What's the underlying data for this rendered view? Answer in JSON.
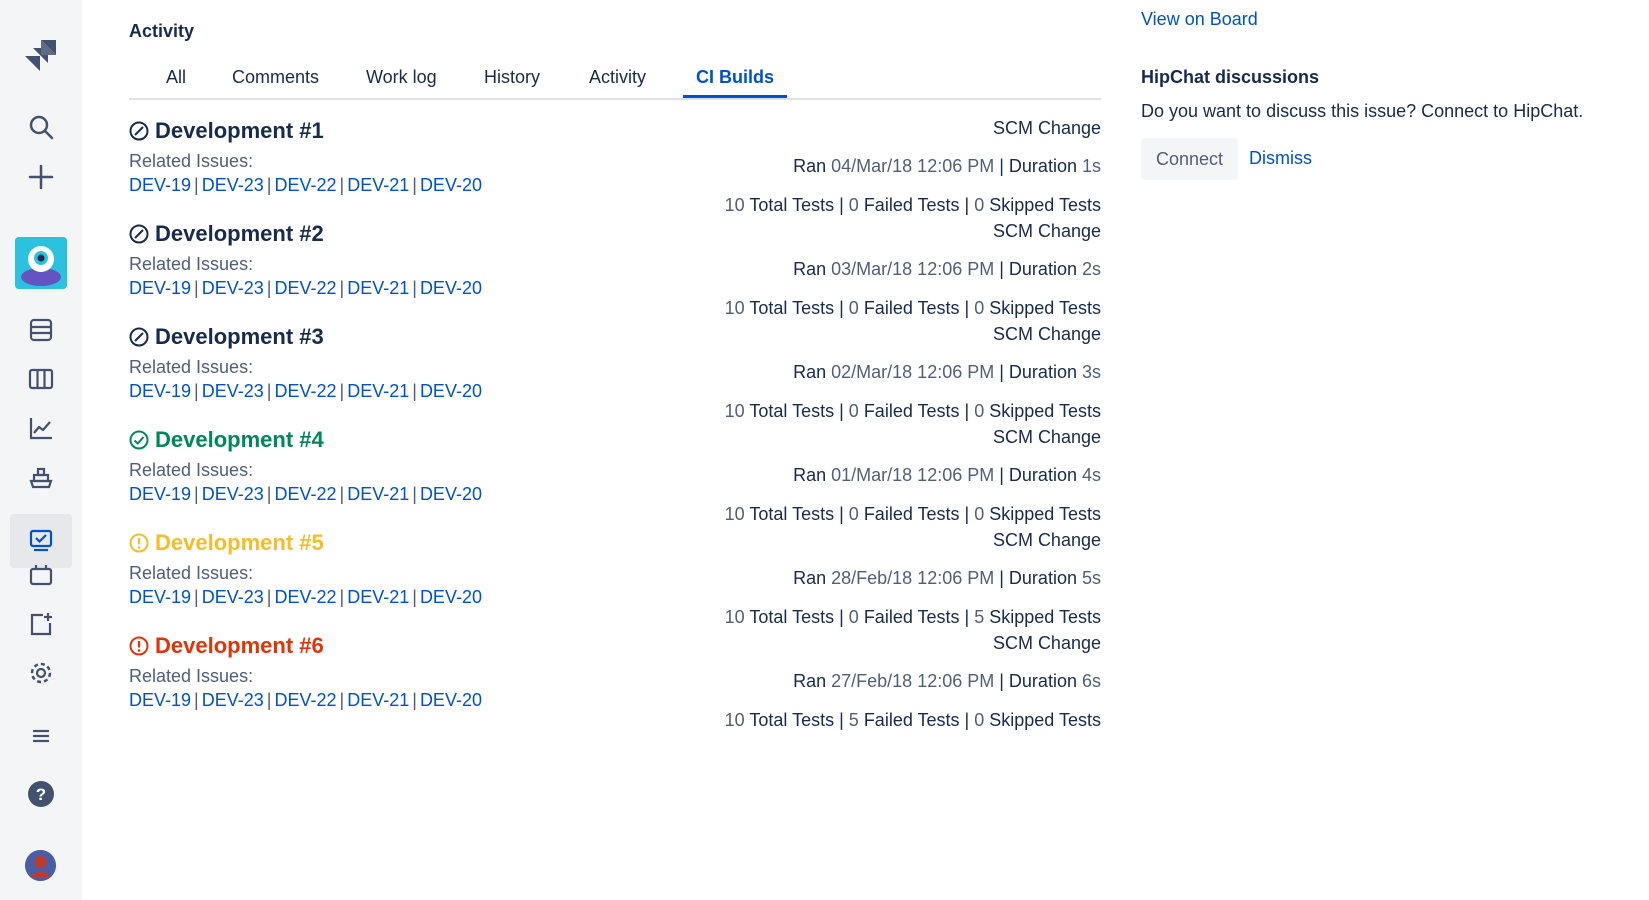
{
  "activity": {
    "title": "Activity",
    "tabs": [
      {
        "label": "All"
      },
      {
        "label": "Comments"
      },
      {
        "label": "Work log"
      },
      {
        "label": "History"
      },
      {
        "label": "Activity"
      },
      {
        "label": "CI Builds",
        "active": true
      }
    ],
    "related_label": "Related Issues:",
    "builds": [
      {
        "title": "Development #1",
        "status": "default",
        "issues": [
          "DEV-19",
          "DEV-23",
          "DEV-22",
          "DEV-21",
          "DEV-20"
        ],
        "scm": "SCM Change",
        "ran_label": "Ran",
        "ran_date": "04/Mar/18 12:06 PM",
        "duration_label": "| Duration",
        "duration": "1s",
        "total": "10",
        "total_label": "Total Tests |",
        "failed": "0",
        "failed_label": "Failed Tests |",
        "skipped": "0",
        "skipped_label": "Skipped Tests"
      },
      {
        "title": "Development #2",
        "status": "default",
        "issues": [
          "DEV-19",
          "DEV-23",
          "DEV-22",
          "DEV-21",
          "DEV-20"
        ],
        "scm": "SCM Change",
        "ran_label": "Ran",
        "ran_date": "03/Mar/18 12:06 PM",
        "duration_label": "| Duration",
        "duration": "2s",
        "total": "10",
        "total_label": "Total Tests |",
        "failed": "0",
        "failed_label": "Failed Tests |",
        "skipped": "0",
        "skipped_label": "Skipped Tests"
      },
      {
        "title": "Development #3",
        "status": "default",
        "issues": [
          "DEV-19",
          "DEV-23",
          "DEV-22",
          "DEV-21",
          "DEV-20"
        ],
        "scm": "SCM Change",
        "ran_label": "Ran",
        "ran_date": "02/Mar/18 12:06 PM",
        "duration_label": "| Duration",
        "duration": "3s",
        "total": "10",
        "total_label": "Total Tests |",
        "failed": "0",
        "failed_label": "Failed Tests |",
        "skipped": "0",
        "skipped_label": "Skipped Tests"
      },
      {
        "title": "Development #4",
        "status": "success",
        "issues": [
          "DEV-19",
          "DEV-23",
          "DEV-22",
          "DEV-21",
          "DEV-20"
        ],
        "scm": "SCM Change",
        "ran_label": "Ran",
        "ran_date": "01/Mar/18 12:06 PM",
        "duration_label": "| Duration",
        "duration": "4s",
        "total": "10",
        "total_label": "Total Tests |",
        "failed": "0",
        "failed_label": "Failed Tests |",
        "skipped": "0",
        "skipped_label": "Skipped Tests"
      },
      {
        "title": "Development #5",
        "status": "warning",
        "issues": [
          "DEV-19",
          "DEV-23",
          "DEV-22",
          "DEV-21",
          "DEV-20"
        ],
        "scm": "SCM Change",
        "ran_label": "Ran",
        "ran_date": "28/Feb/18 12:06 PM",
        "duration_label": "| Duration",
        "duration": "5s",
        "total": "10",
        "total_label": "Total Tests |",
        "failed": "0",
        "failed_label": "Failed Tests |",
        "skipped": "5",
        "skipped_label": "Skipped Tests"
      },
      {
        "title": "Development #6",
        "status": "error",
        "issues": [
          "DEV-19",
          "DEV-23",
          "DEV-22",
          "DEV-21",
          "DEV-20"
        ],
        "scm": "SCM Change",
        "ran_label": "Ran",
        "ran_date": "27/Feb/18 12:06 PM",
        "duration_label": "| Duration",
        "duration": "6s",
        "total": "10",
        "total_label": "Total Tests |",
        "failed": "5",
        "failed_label": "Failed Tests |",
        "skipped": "0",
        "skipped_label": "Skipped Tests"
      }
    ]
  },
  "right_panel": {
    "view_on_board": "View on Board",
    "hipchat_title": "HipChat discussions",
    "hipchat_text": "Do you want to discuss this issue? Connect to HipChat.",
    "connect_label": "Connect",
    "dismiss_label": "Dismiss"
  },
  "sidebar": {
    "icons": [
      "jira-logo-icon",
      "search-icon",
      "create-plus-icon",
      "project-avatar",
      "backlog-icon",
      "board-icon",
      "reports-icon",
      "releases-icon",
      "ci-builds-icon",
      "components-icon",
      "add-item-icon",
      "settings-gear-icon",
      "menu-icon",
      "help-icon",
      "user-avatar"
    ]
  },
  "colors": {
    "link": "#0052cc",
    "text": "#172b4d",
    "muted": "#505f79",
    "success": "#00875a",
    "warning": "#f5bd29",
    "error": "#de350b",
    "sidebar_bg": "#f4f5f7",
    "project_avatar": "#2bc2e0"
  }
}
